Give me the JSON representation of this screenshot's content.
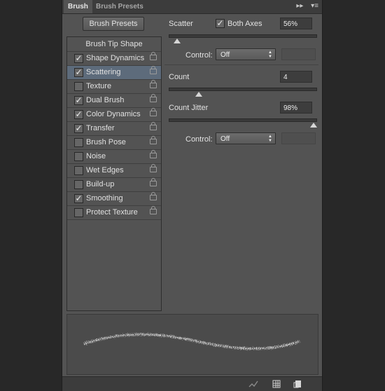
{
  "tabs": [
    {
      "label": "Brush"
    },
    {
      "label": "Brush Presets"
    }
  ],
  "tab_icons": [
    "collapse-icon",
    "panel-menu-icon"
  ],
  "presets_button": "Brush Presets",
  "list": {
    "title": "Brush Tip Shape",
    "items": [
      {
        "label": "Shape Dynamics",
        "checked": true
      },
      {
        "label": "Scattering",
        "checked": true,
        "selected": true
      },
      {
        "label": "Texture",
        "checked": false
      },
      {
        "label": "Dual Brush",
        "checked": true
      },
      {
        "label": "Color Dynamics",
        "checked": true
      },
      {
        "label": "Transfer",
        "checked": true
      },
      {
        "label": "Brush Pose",
        "checked": false
      },
      {
        "label": "Noise",
        "checked": false
      },
      {
        "label": "Wet Edges",
        "checked": false
      },
      {
        "label": "Build-up",
        "checked": false
      },
      {
        "label": "Smoothing",
        "checked": true
      },
      {
        "label": "Protect Texture",
        "checked": false
      }
    ]
  },
  "scatter": {
    "label": "Scatter",
    "both_axes_label": "Both Axes",
    "both_axes_checked": true,
    "value": "56%",
    "slider_fraction": 0.05,
    "control_label": "Control:",
    "control_value": "Off"
  },
  "count": {
    "label": "Count",
    "value": "4",
    "slider_fraction": 0.2
  },
  "count_jitter": {
    "label": "Count Jitter",
    "value": "98%",
    "slider_fraction": 0.98,
    "control_label": "Control:",
    "control_value": "Off"
  },
  "footer_icons": [
    "toggle-live-tip-icon",
    "brush-grid-icon",
    "new-preset-icon"
  ],
  "colors": {
    "panel_bg": "#535353",
    "selected_row": "#5d6b7b",
    "tab_bar": "#3c3c3c"
  }
}
